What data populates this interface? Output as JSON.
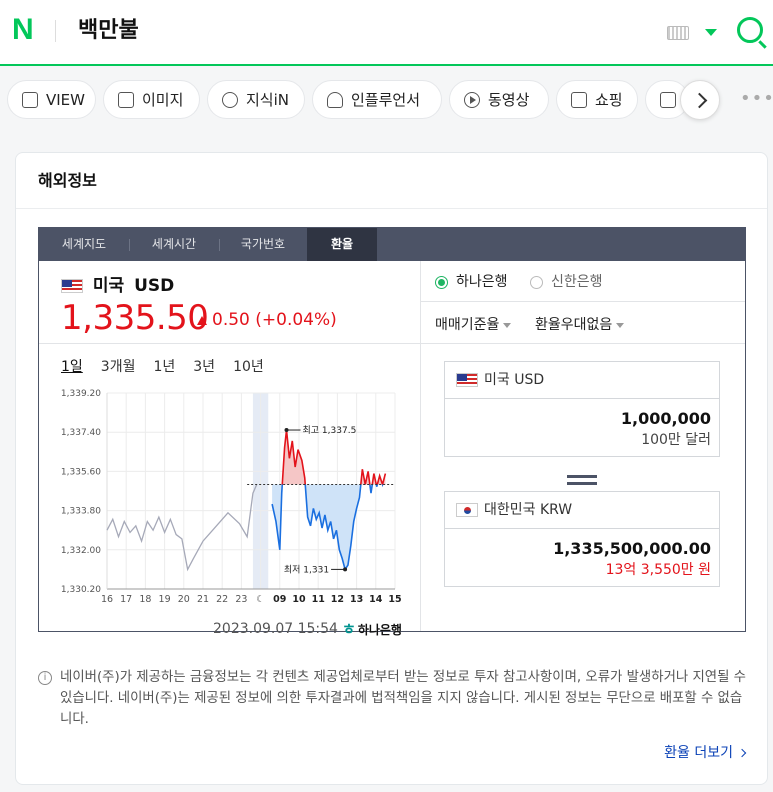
{
  "header": {
    "logo": "N",
    "query": "백만불"
  },
  "tabs": [
    {
      "label": "VIEW"
    },
    {
      "label": "이미지"
    },
    {
      "label": "지식iN"
    },
    {
      "label": "인플루언서"
    },
    {
      "label": "동영상"
    },
    {
      "label": "쇼핑"
    }
  ],
  "more_menu": "•••",
  "card": {
    "title": "해외정보"
  },
  "widget": {
    "tabs": [
      "세계지도",
      "세계시간",
      "국가번호",
      "환율"
    ],
    "active_tab": "환율",
    "currency": {
      "country": "미국",
      "code": "USD"
    },
    "rate": "1,335.50",
    "change": "0.50 (+0.04%)",
    "periods": [
      "1일",
      "3개월",
      "1년",
      "3년",
      "10년"
    ],
    "active_period": "1일",
    "timestamp": "2023.09.07 15:54",
    "bank_logo": "하나은행",
    "banks": [
      "하나은행",
      "신한은행"
    ],
    "selected_bank": "하나은행",
    "dropdowns": [
      "매매기준율",
      "환율우대없음"
    ],
    "from": {
      "label": "미국 USD",
      "value": "1,000,000",
      "sub": "100만 달러"
    },
    "to": {
      "label": "대한민국 KRW",
      "value": "1,335,500,000.00",
      "sub": "13억 3,550만 원"
    }
  },
  "notice": "네이버(주)가 제공하는 금융정보는 각 컨텐츠 제공업체로부터 받는 정보로 투자 참고사항이며, 오류가 발생하거나 지연될 수 있습니다. 네이버(주)는 제공된 정보에 의한 투자결과에 법적책임을 지지 않습니다. 게시된 정보는 무단으로 배포할 수 없습니다.",
  "more_link": "환율 더보기",
  "colors": {
    "brand": "#03c75a",
    "up": "#e3131b",
    "down": "#1a6fe0"
  },
  "chart_data": {
    "type": "line",
    "yticks": [
      "1,339.20",
      "1,337.40",
      "1,335.60",
      "1,333.80",
      "1,332.00",
      "1,330.20"
    ],
    "ylim": [
      1330.2,
      1339.2
    ],
    "xticks": [
      "16",
      "17",
      "18",
      "19",
      "20",
      "21",
      "22",
      "23",
      "☾",
      "09",
      "10",
      "11",
      "12",
      "13",
      "14",
      "15"
    ],
    "reference": 1335.0,
    "high_label": "최고 1,337.5",
    "low_label": "최저 1,331",
    "prev_series": [
      [
        0.0,
        1332.9
      ],
      [
        0.3,
        1333.4
      ],
      [
        0.6,
        1332.6
      ],
      [
        0.9,
        1333.3
      ],
      [
        1.2,
        1332.8
      ],
      [
        1.5,
        1333.1
      ],
      [
        1.8,
        1332.4
      ],
      [
        2.1,
        1333.3
      ],
      [
        2.4,
        1332.9
      ],
      [
        2.7,
        1333.5
      ],
      [
        3.0,
        1332.8
      ],
      [
        3.3,
        1333.4
      ],
      [
        3.6,
        1332.7
      ],
      [
        3.9,
        1332.5
      ],
      [
        4.2,
        1331.1
      ],
      [
        4.5,
        1331.6
      ],
      [
        5.0,
        1332.4
      ],
      [
        5.6,
        1333.0
      ],
      [
        6.3,
        1333.7
      ],
      [
        6.9,
        1333.2
      ],
      [
        7.3,
        1332.6
      ],
      [
        7.6,
        1334.6
      ],
      [
        7.8,
        1335.0
      ]
    ],
    "today_series": [
      [
        8.6,
        1334.1
      ],
      [
        8.8,
        1333.3
      ],
      [
        9.0,
        1332.0
      ],
      [
        9.1,
        1334.6
      ],
      [
        9.25,
        1336.7
      ],
      [
        9.35,
        1337.5
      ],
      [
        9.5,
        1336.2
      ],
      [
        9.65,
        1337.0
      ],
      [
        9.8,
        1335.8
      ],
      [
        9.95,
        1336.6
      ],
      [
        10.15,
        1336.1
      ],
      [
        10.3,
        1335.3
      ],
      [
        10.45,
        1333.5
      ],
      [
        10.6,
        1333.1
      ],
      [
        10.75,
        1333.9
      ],
      [
        10.9,
        1333.4
      ],
      [
        11.05,
        1333.7
      ],
      [
        11.2,
        1333.0
      ],
      [
        11.35,
        1333.6
      ],
      [
        11.5,
        1332.9
      ],
      [
        11.65,
        1333.3
      ],
      [
        11.8,
        1332.5
      ],
      [
        11.95,
        1332.9
      ],
      [
        12.1,
        1332.0
      ],
      [
        12.25,
        1331.6
      ],
      [
        12.4,
        1331.1
      ],
      [
        12.55,
        1331.3
      ],
      [
        12.7,
        1332.2
      ],
      [
        12.85,
        1333.3
      ],
      [
        13.0,
        1333.9
      ],
      [
        13.15,
        1334.4
      ],
      [
        13.3,
        1335.7
      ],
      [
        13.45,
        1335.0
      ],
      [
        13.6,
        1335.6
      ],
      [
        13.75,
        1334.6
      ],
      [
        13.9,
        1335.5
      ],
      [
        14.05,
        1334.9
      ],
      [
        14.2,
        1335.4
      ],
      [
        14.35,
        1335.0
      ],
      [
        14.5,
        1335.5
      ]
    ]
  }
}
